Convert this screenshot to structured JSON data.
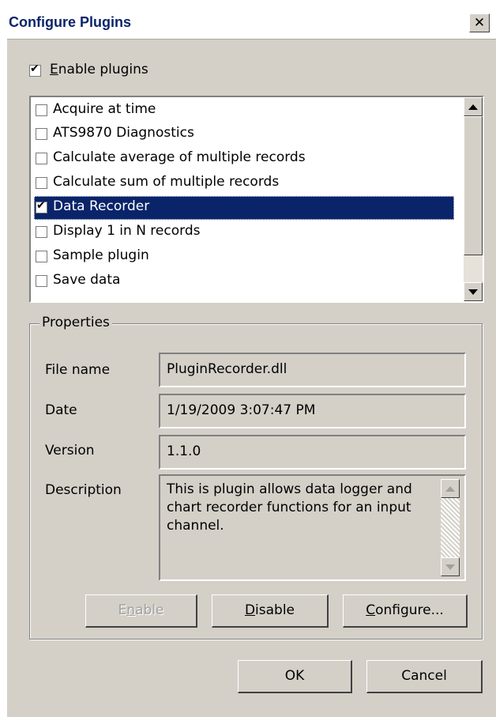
{
  "window": {
    "title": "Configure Plugins",
    "close_glyph": "✕"
  },
  "enable_plugins": {
    "label": "Enable plugins",
    "checked": true
  },
  "plugins": [
    {
      "label": "Acquire at time",
      "checked": false
    },
    {
      "label": "ATS9870 Diagnostics",
      "checked": false
    },
    {
      "label": "Calculate average of multiple records",
      "checked": false
    },
    {
      "label": "Calculate sum of multiple records",
      "checked": false
    },
    {
      "label": "Data Recorder",
      "checked": true,
      "selected": true
    },
    {
      "label": "Display 1 in N records",
      "checked": false
    },
    {
      "label": "Sample plugin",
      "checked": false
    },
    {
      "label": "Save data",
      "checked": false
    }
  ],
  "properties": {
    "group_title": "Properties",
    "file_name_label": "File name",
    "file_name": "PluginRecorder.dll",
    "date_label": "Date",
    "date": "1/19/2009 3:07:47 PM",
    "version_label": "Version",
    "version": "1.1.0",
    "description_label": "Description",
    "description": "This is plugin allows data logger and chart recorder functions for an input channel."
  },
  "buttons": {
    "enable": "Enable",
    "disable": "Disable",
    "configure": "Configure...",
    "ok": "OK",
    "cancel": "Cancel"
  },
  "colors": {
    "selection": "#0a246a",
    "face": "#d4d0c8"
  }
}
